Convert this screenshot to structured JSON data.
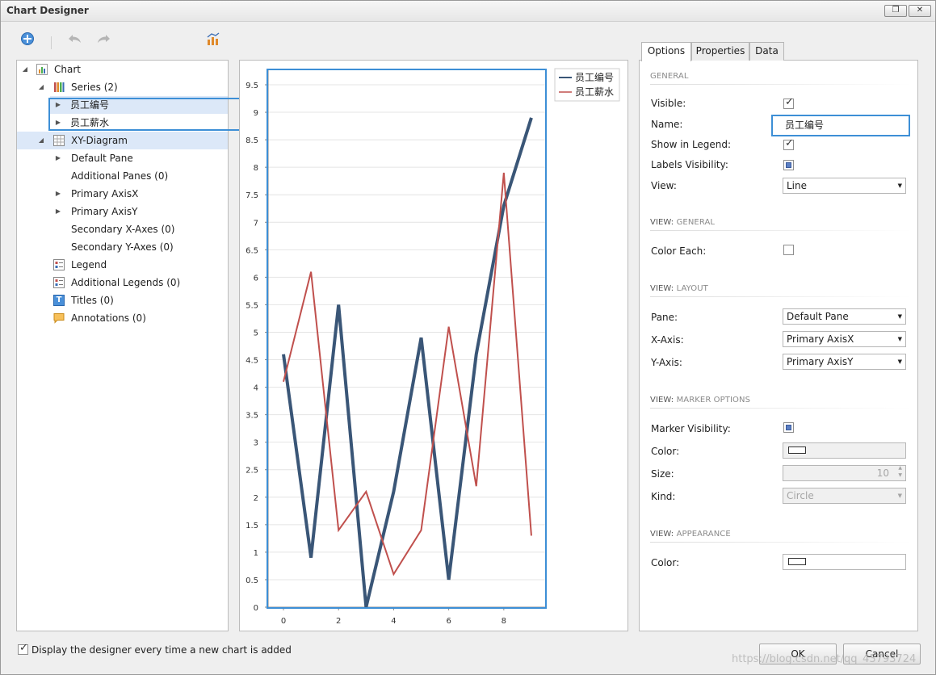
{
  "window": {
    "title": "Chart Designer",
    "restore_glyph": "❐",
    "close_glyph": "✕"
  },
  "toolbar": {
    "add_icon": "add-circle-icon",
    "undo_icon": "undo-icon",
    "redo_icon": "redo-icon",
    "wizard_icon": "chart-wizard-icon"
  },
  "tree": {
    "items": [
      {
        "label": "Chart",
        "icon": "chart-icon"
      },
      {
        "label": "Series (2)",
        "icon": "series-icon"
      },
      {
        "label": "员工编号"
      },
      {
        "label": "员工薪水"
      },
      {
        "label": "XY-Diagram",
        "icon": "grid-icon"
      },
      {
        "label": "Default Pane"
      },
      {
        "label": "Additional Panes (0)"
      },
      {
        "label": "Primary AxisX"
      },
      {
        "label": "Primary AxisY"
      },
      {
        "label": "Secondary X-Axes (0)"
      },
      {
        "label": "Secondary Y-Axes (0)"
      },
      {
        "label": "Legend",
        "icon": "legend-icon"
      },
      {
        "label": "Additional Legends (0)",
        "icon": "legend-icon"
      },
      {
        "label": "Titles (0)",
        "icon": "title-icon",
        "icon_letter": "T"
      },
      {
        "label": "Annotations (0)",
        "icon": "annotation-icon"
      }
    ]
  },
  "chart_data": {
    "type": "line",
    "x": [
      0,
      1,
      2,
      3,
      4,
      5,
      6,
      7,
      8,
      9
    ],
    "series": [
      {
        "name": "员工编号",
        "values": [
          4.6,
          0.9,
          5.5,
          0.0,
          2.1,
          4.9,
          0.5,
          4.6,
          7.3,
          8.9
        ],
        "color": "#3a5677"
      },
      {
        "name": "员工薪水",
        "values": [
          4.1,
          6.1,
          1.4,
          2.1,
          0.6,
          1.4,
          5.1,
          2.2,
          7.9,
          1.3
        ],
        "color": "#c0504d"
      }
    ],
    "ylim": [
      0,
      9.5
    ],
    "yticks": [
      "0",
      "0.5",
      "1",
      "1.5",
      "2",
      "2.5",
      "3",
      "3.5",
      "4",
      "4.5",
      "5",
      "5.5",
      "6",
      "6.5",
      "7",
      "7.5",
      "8",
      "8.5",
      "9",
      "9.5"
    ],
    "xticks": [
      "0",
      "2",
      "4",
      "6",
      "8"
    ],
    "grid": "horizontal",
    "legend": "top-right"
  },
  "tabs": [
    "Options",
    "Properties",
    "Data"
  ],
  "options": {
    "general_header": "GENERAL",
    "visible_label": "Visible:",
    "name_label": "Name:",
    "name_value": "员工编号",
    "show_legend_label": "Show in Legend:",
    "labels_visibility_label": "Labels Visibility:",
    "view_label": "View:",
    "view_value": "Line",
    "view_general_prefix": "VIEW: ",
    "view_general_suffix": "GENERAL",
    "color_each_label": "Color Each:",
    "view_layout_prefix": "VIEW: ",
    "view_layout_suffix": "LAYOUT",
    "pane_label": "Pane:",
    "pane_value": "Default Pane",
    "xaxis_label": "X-Axis:",
    "xaxis_value": "Primary AxisX",
    "yaxis_label": "Y-Axis:",
    "yaxis_value": "Primary AxisY",
    "view_marker_prefix": "VIEW: ",
    "view_marker_suffix": "MARKER OPTIONS",
    "marker_visibility_label": "Marker Visibility:",
    "marker_color_label": "Color:",
    "size_label": "Size:",
    "size_value": "10",
    "kind_label": "Kind:",
    "kind_value": "Circle",
    "view_appearance_prefix": "VIEW: ",
    "view_appearance_suffix": "APPEARANCE",
    "appearance_color_label": "Color:",
    "check_glyph": "✓",
    "combo_arrow_glyph": "▼",
    "spin_up_glyph": "▲",
    "spin_down_glyph": "▼"
  },
  "footer": {
    "display_designer_label": "Display the designer every time a new chart is added",
    "ok_label": "OK",
    "cancel_label": "Cancel",
    "watermark": "https://blog.csdn.net/qq_43793724"
  },
  "colors": {
    "accent_blue": "#3d8fd6",
    "series1": "#3a5677",
    "series2": "#c0504d"
  }
}
